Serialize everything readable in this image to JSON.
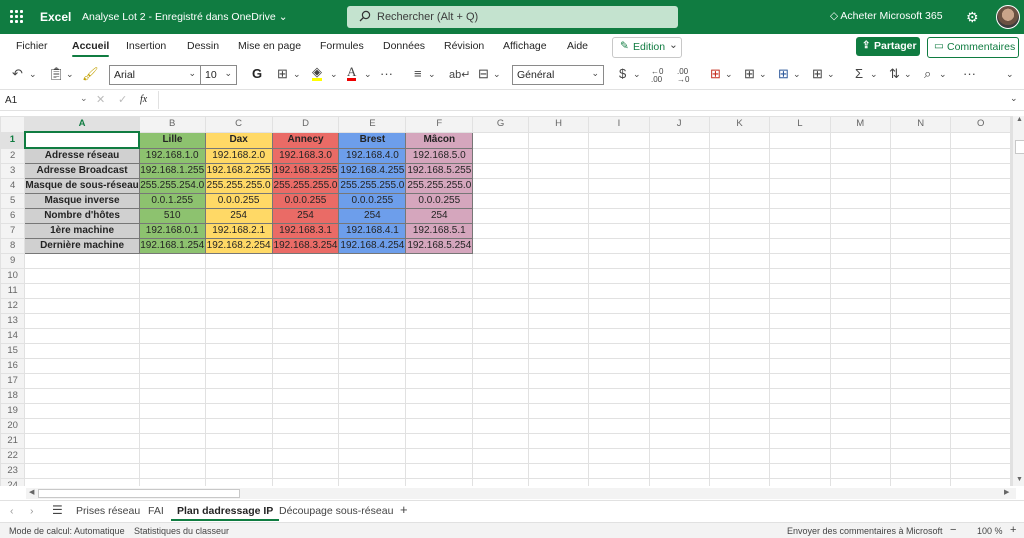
{
  "titlebar": {
    "app": "Excel",
    "document": "Analyse Lot 2  -  Enregistré dans OneDrive",
    "search_placeholder": "Rechercher (Alt + Q)",
    "buy": "Acheter Microsoft 365",
    "brand_color": "#107c41"
  },
  "menu": {
    "tabs": [
      "Fichier",
      "Accueil",
      "Insertion",
      "Dessin",
      "Mise en page",
      "Formules",
      "Données",
      "Révision",
      "Affichage",
      "Aide"
    ],
    "active": "Accueil",
    "edition": "Edition",
    "share": "Partager",
    "comments": "Commentaires"
  },
  "ribbon": {
    "font": "Arial",
    "size": "10",
    "bold": "G",
    "format": "Général",
    "currency": "$",
    "more": "···"
  },
  "formula_bar": {
    "name_box": "A1",
    "fx": "fx",
    "value": ""
  },
  "sheet": {
    "columns": [
      "A",
      "B",
      "C",
      "D",
      "E",
      "F",
      "G",
      "H",
      "I",
      "J",
      "K",
      "L",
      "M",
      "N",
      "O"
    ],
    "rows": [
      "1",
      "2",
      "3",
      "4",
      "5",
      "6",
      "7",
      "8",
      "9",
      "10",
      "11",
      "12",
      "13",
      "14",
      "15",
      "16",
      "17",
      "18",
      "19",
      "20",
      "21",
      "22",
      "23",
      "24"
    ],
    "headers": [
      "Lille",
      "Dax",
      "Annecy",
      "Brest",
      "Mâcon"
    ],
    "header_colors": [
      "#8dc26f",
      "#ffd966",
      "#ea6b66",
      "#6d9eeb",
      "#d5a6bd"
    ],
    "data": [
      {
        "label": "Adresse réseau",
        "values": [
          "192.168.1.0",
          "192.168.2.0",
          "192.168.3.0",
          "192.168.4.0",
          "192.168.5.0"
        ]
      },
      {
        "label": "Adresse Broadcast",
        "values": [
          "192.168.1.255",
          "192.168.2.255",
          "192.168.3.255",
          "192.168.4.255",
          "192.168.5.255"
        ]
      },
      {
        "label": "Masque de sous-réseau",
        "values": [
          "255.255.254.0",
          "255.255.255.0",
          "255.255.255.0",
          "255.255.255.0",
          "255.255.255.0"
        ]
      },
      {
        "label": "Masque inverse",
        "values": [
          "0.0.1.255",
          "0.0.0.255",
          "0.0.0.255",
          "0.0.0.255",
          "0.0.0.255"
        ]
      },
      {
        "label": "Nombre d'hôtes",
        "values": [
          "510",
          "254",
          "254",
          "254",
          "254"
        ]
      },
      {
        "label": "1ère machine",
        "values": [
          "192.168.0.1",
          "192.168.2.1",
          "192.168.3.1",
          "192.168.4.1",
          "192.168.5.1"
        ]
      },
      {
        "label": "Dernière machine",
        "values": [
          "192.168.1.254",
          "192.168.2.254",
          "192.168.3.254",
          "192.168.4.254",
          "192.168.5.254"
        ]
      }
    ],
    "label_bg": "#d0d0d0"
  },
  "sheet_tabs": {
    "tabs": [
      "Prises réseau",
      "FAI",
      "Plan dadressage IP",
      "Découpage sous-réseau"
    ],
    "active": "Plan dadressage IP"
  },
  "status": {
    "calc_mode": "Mode de calcul: Automatique",
    "stats": "Statistiques du classeur",
    "feedback": "Envoyer des commentaires à Microsoft",
    "zoom_minus": "−",
    "zoom": "100 %",
    "zoom_plus": "+"
  }
}
